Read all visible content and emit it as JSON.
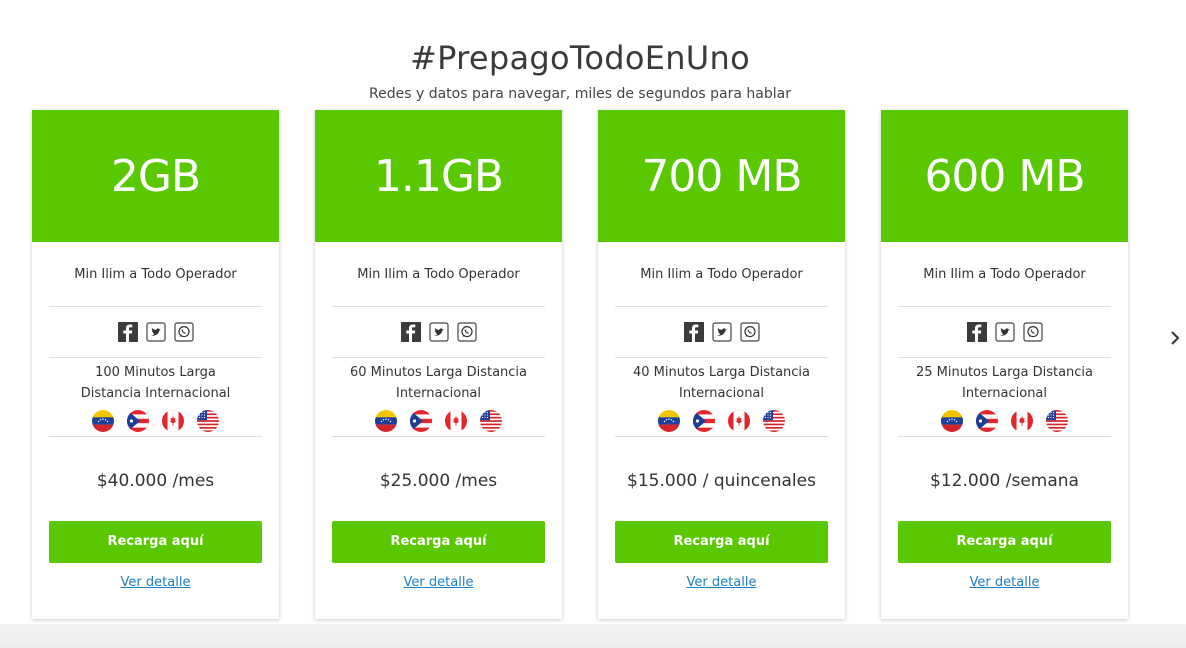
{
  "header": {
    "title": "#PrepagoTodoEnUno",
    "subtitle": "Redes y datos para navegar, miles de segundos para hablar"
  },
  "colors": {
    "brand_green": "#5ac800",
    "link_blue": "#1a7fc7"
  },
  "social_icons": [
    "facebook-icon",
    "twitter-icon",
    "whatsapp-icon"
  ],
  "flag_icons": [
    "venezuela-flag-icon",
    "puerto-rico-flag-icon",
    "canada-flag-icon",
    "usa-flag-icon"
  ],
  "plans": [
    {
      "data": "2GB",
      "minutes": "Min Ilim a Todo Operador",
      "ld_minutes": "100 Minutos Larga Distancia Internacional",
      "price": "$40.000 /mes",
      "button": "Recarga aquí",
      "detail": "Ver detalle"
    },
    {
      "data": "1.1GB",
      "minutes": "Min Ilim a Todo Operador",
      "ld_minutes": "60 Minutos Larga Distancia Internacional",
      "price": "$25.000 /mes",
      "button": "Recarga aquí",
      "detail": "Ver detalle"
    },
    {
      "data": "700 MB",
      "minutes": "Min Ilim a Todo Operador",
      "ld_minutes": "40 Minutos Larga Distancia Internacional",
      "price": "$15.000 / quincenales",
      "button": "Recarga aquí",
      "detail": "Ver detalle"
    },
    {
      "data": "600 MB",
      "minutes": "Min Ilim a Todo Operador",
      "ld_minutes": "25 Minutos Larga Distancia Internacional",
      "price": "$12.000 /semana",
      "button": "Recarga aquí",
      "detail": "Ver detalle"
    }
  ],
  "carousel": {
    "next_icon": "chevron-right-icon"
  }
}
